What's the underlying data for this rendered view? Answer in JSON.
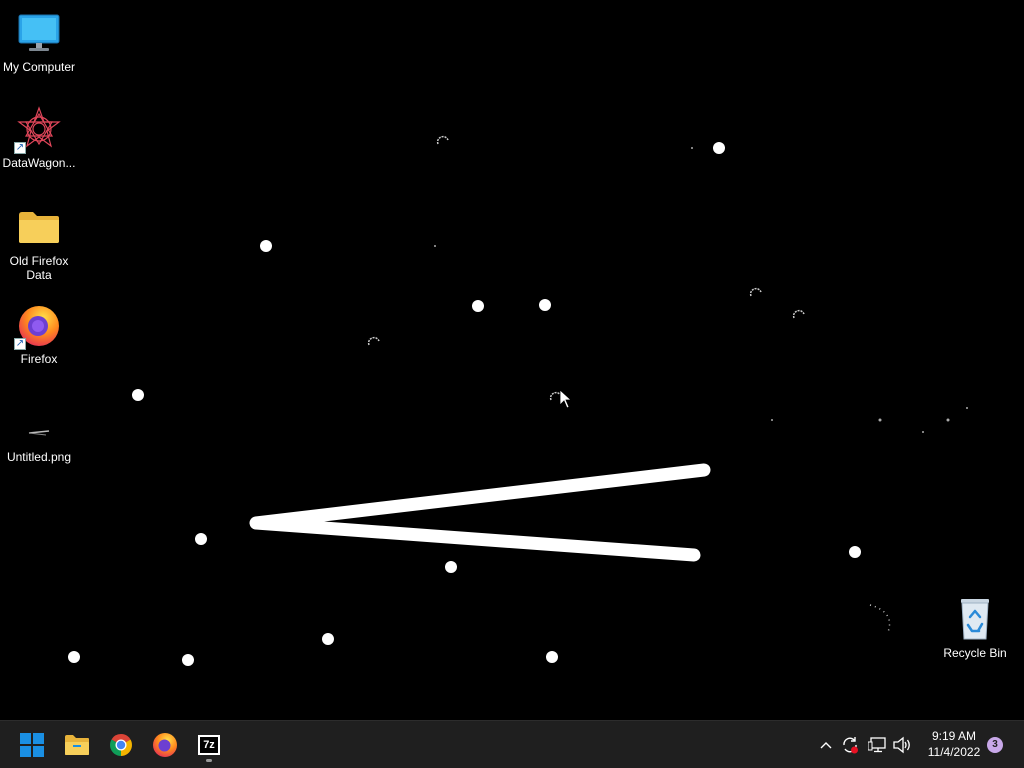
{
  "desktop": {
    "icons": [
      {
        "label": "My Computer",
        "icon": "monitor-icon"
      },
      {
        "label": "DataWagon...",
        "icon": "datawagon-icon"
      },
      {
        "label": "Old Firefox Data",
        "icon": "folder-icon"
      },
      {
        "label": "Firefox",
        "icon": "firefox-icon"
      },
      {
        "label": "Untitled.png",
        "icon": "image-file-icon"
      },
      {
        "label": "Recycle Bin",
        "icon": "recycle-bin-icon"
      }
    ]
  },
  "taskbar": {
    "apps": [
      {
        "name": "Start",
        "icon": "windows-start-icon"
      },
      {
        "name": "File Explorer",
        "icon": "file-explorer-icon"
      },
      {
        "name": "Google Chrome",
        "icon": "chrome-icon"
      },
      {
        "name": "Firefox",
        "icon": "firefox-icon"
      },
      {
        "name": "7-Zip",
        "icon": "7zip-icon",
        "label": "7z"
      }
    ],
    "tray": {
      "icons": [
        "chevron-up-icon",
        "sync-icon",
        "network-icon",
        "volume-icon"
      ],
      "time": "9:19 AM",
      "date": "11/4/2022",
      "notification_count": "3"
    }
  },
  "colors": {
    "desktop_background": "#000000",
    "taskbar_background": "#1f1f1f",
    "accent_blue": "#1a8fe3",
    "notification_badge": "#c8a8e9"
  }
}
